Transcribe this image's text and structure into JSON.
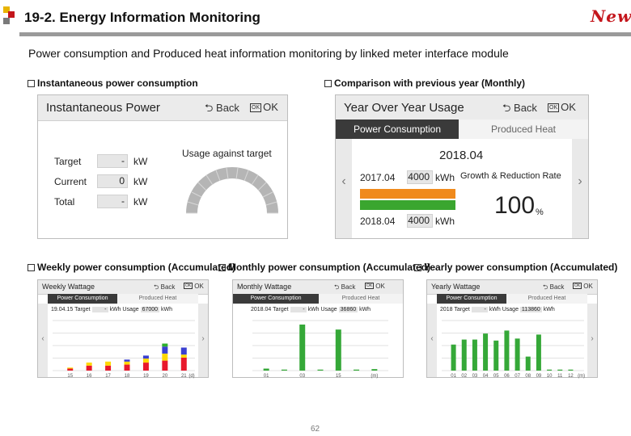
{
  "header": {
    "title": "19-2. Energy Information Monitoring",
    "badge": "New",
    "subtitle": "Power consumption and Produced heat information monitoring by linked meter interface module"
  },
  "sections": {
    "instantaneous": "Instantaneous power consumption",
    "comparison": "Comparison with previous year (Monthly)",
    "weekly": "Weekly power consumption (Accumulated)",
    "monthly": "Monthly power consumption (Accumulated)",
    "yearly": "Yearly power consumption (Accumulated)"
  },
  "common": {
    "back": "Back",
    "ok": "OK",
    "ok_icon": "OK",
    "tab_power": "Power Consumption",
    "tab_heat": "Produced Heat",
    "prev_arrow": "‹",
    "next_arrow": "›"
  },
  "instant_panel": {
    "title": "Instantaneous Power",
    "rows": [
      {
        "label": "Target",
        "value": "-",
        "unit": "kW"
      },
      {
        "label": "Current",
        "value": "0",
        "unit": "kW"
      },
      {
        "label": "Total",
        "value": "-",
        "unit": "kW"
      }
    ],
    "gauge_label": "Usage against target",
    "gauge_level": 0
  },
  "yoy_panel": {
    "title": "Year Over Year Usage",
    "date": "2018.04",
    "rows": [
      {
        "date": "2017.04",
        "value": "4000",
        "unit": "kWh",
        "ratio": 1.0
      },
      {
        "date": "2018.04",
        "value": "4000",
        "unit": "kWh",
        "ratio": 1.0
      }
    ],
    "growth_label": "Growth & Reduction Rate",
    "growth_value": "100",
    "growth_unit": "%",
    "colors": {
      "orange": "#f08a1c",
      "green": "#3aa62f"
    }
  },
  "weekly_panel": {
    "title": "Weekly Wattage",
    "date": "19.04.15",
    "target_label": "Target",
    "target_value": "-",
    "unit": "kWh",
    "usage_label": "Usage",
    "usage_value": "67000",
    "x_labels": [
      "15",
      "16",
      "17",
      "18",
      "19",
      "20",
      "21"
    ],
    "x_unit": "(d)"
  },
  "monthly_panel": {
    "title": "Monthly Wattage",
    "date": "2018.04",
    "target_label": "Target",
    "target_value": "-",
    "unit": "kWh",
    "usage_label": "Usage",
    "usage_value": "36860",
    "x_labels": [
      "01",
      "",
      "03",
      "",
      "15",
      "",
      "(m)"
    ],
    "bars": [
      0.04,
      0.02,
      0.92,
      0.02,
      0.82,
      0.02,
      0.03
    ]
  },
  "yearly_panel": {
    "title": "Yearly Wattage",
    "date": "2018",
    "target_label": "Target",
    "target_value": "-",
    "unit": "kWh",
    "usage_label": "Usage",
    "usage_value": "113860",
    "x_labels": [
      "01",
      "02",
      "03",
      "04",
      "05",
      "06",
      "07",
      "08",
      "09",
      "10",
      "11",
      "12",
      "(m)"
    ],
    "bars": [
      0.52,
      0.62,
      0.62,
      0.74,
      0.6,
      0.8,
      0.64,
      0.28,
      0.72,
      0.02,
      0.02,
      0.02
    ]
  },
  "weekly_chart": {
    "type": "bar",
    "categories": [
      "15",
      "16",
      "17",
      "18",
      "19",
      "20",
      "21"
    ],
    "series": [
      {
        "color": "#e8192c",
        "values": [
          0.04,
          0.1,
          0.1,
          0.12,
          0.16,
          0.2,
          0.26
        ]
      },
      {
        "color": "#ffd800",
        "values": [
          0.02,
          0.06,
          0.08,
          0.06,
          0.08,
          0.14,
          0.06
        ]
      },
      {
        "color": "#3a3fd0",
        "values": [
          0,
          0,
          0,
          0.04,
          0.06,
          0.14,
          0.14
        ]
      },
      {
        "color": "#2cb02c",
        "values": [
          0,
          0,
          0,
          0,
          0,
          0.06,
          0
        ]
      }
    ]
  },
  "page_number": "62"
}
